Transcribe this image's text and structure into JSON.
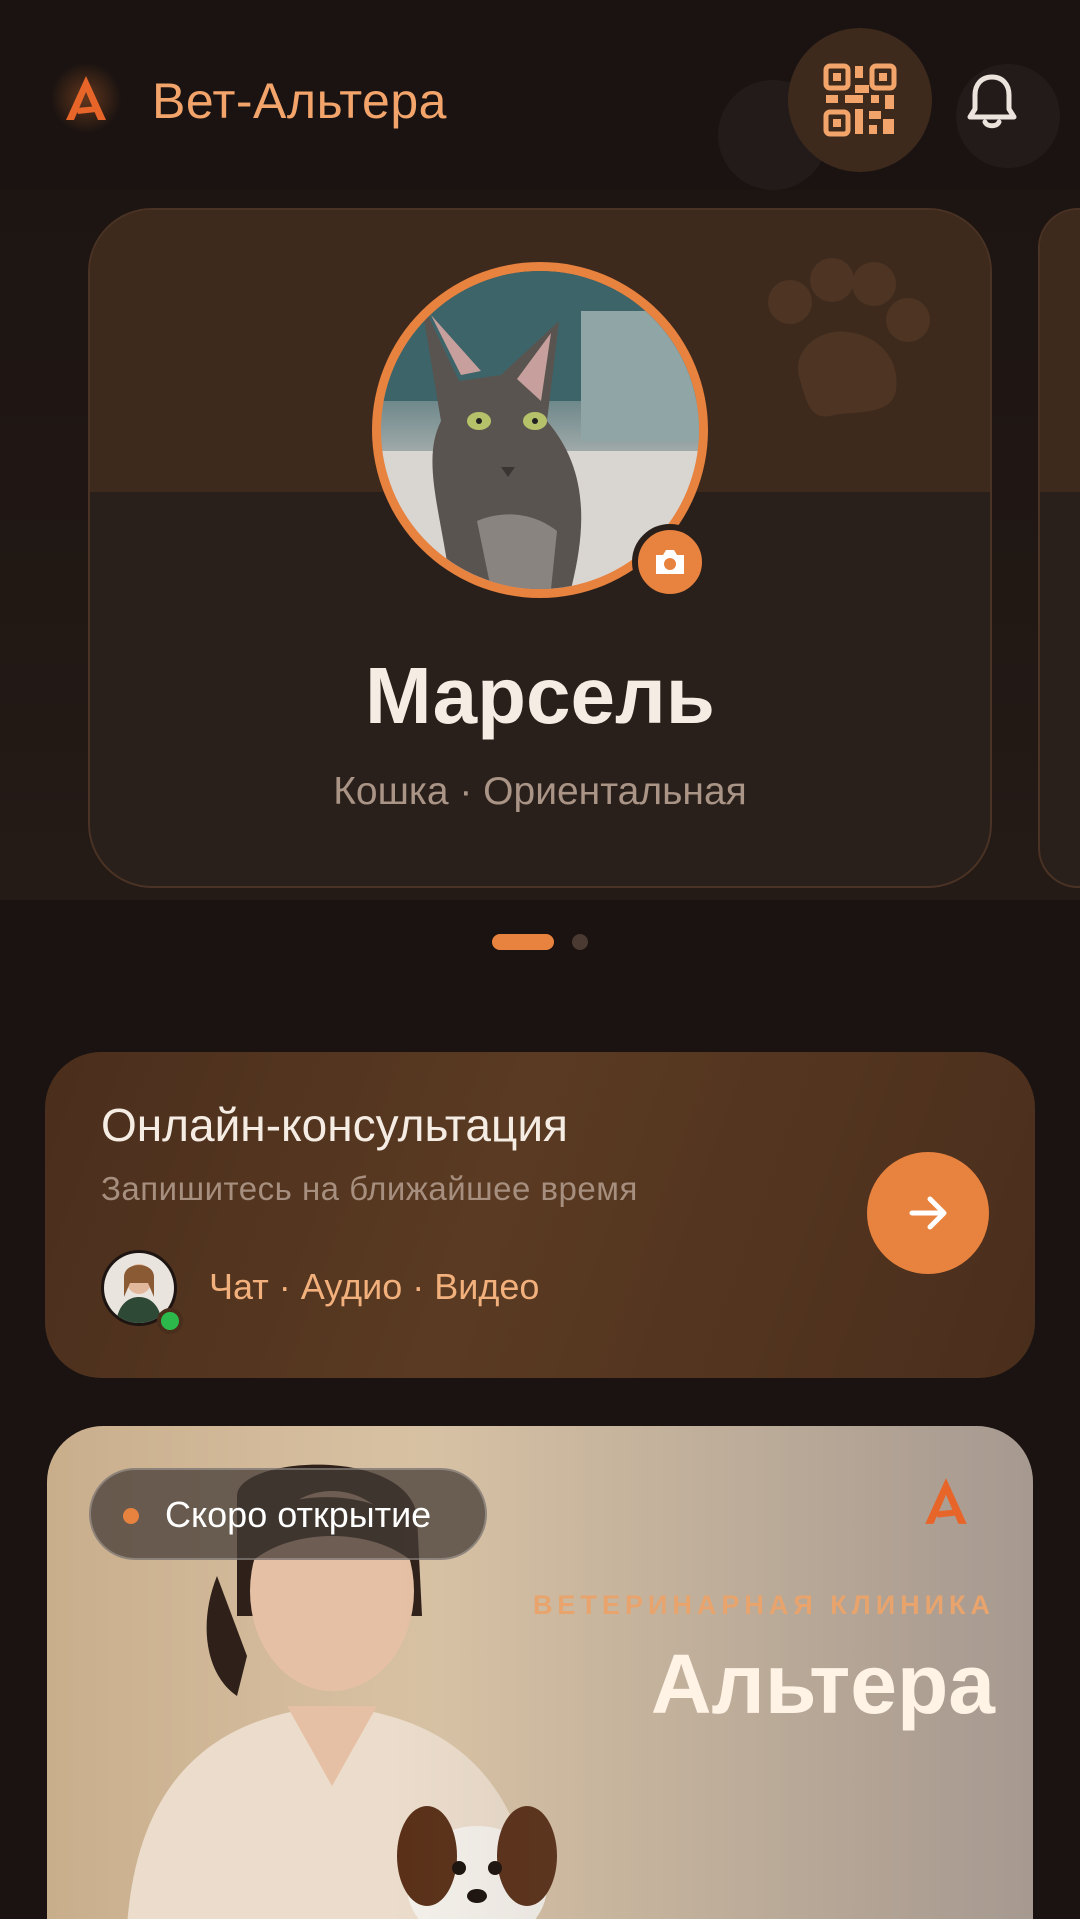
{
  "header": {
    "app_title": "Вет-Альтера",
    "logo_icon": "altera-logo-icon",
    "qr_icon": "qr-code-icon",
    "bell_icon": "bell-icon"
  },
  "pet_carousel": {
    "pets": [
      {
        "name": "Марсель",
        "breed": "Кошка · Ориентальная",
        "photo": "cat-photo"
      }
    ],
    "page_count": 2,
    "active_page": 1,
    "camera_icon": "camera-icon"
  },
  "consultation": {
    "title": "Онлайн-консультация",
    "subtitle": "Запишитесь на ближайшее время",
    "modes": "Чат · Аудио · Видео",
    "doctor_status": "online",
    "arrow_icon": "arrow-right-icon"
  },
  "clinic_banner": {
    "badge": "Скоро открытие",
    "kicker": "ВЕТЕРИНАРНАЯ КЛИНИКА",
    "name": "Альтера"
  },
  "colors": {
    "background": "#1a1311",
    "accent": "#e8823f",
    "card": "#2a201b",
    "online": "#2db84c"
  }
}
